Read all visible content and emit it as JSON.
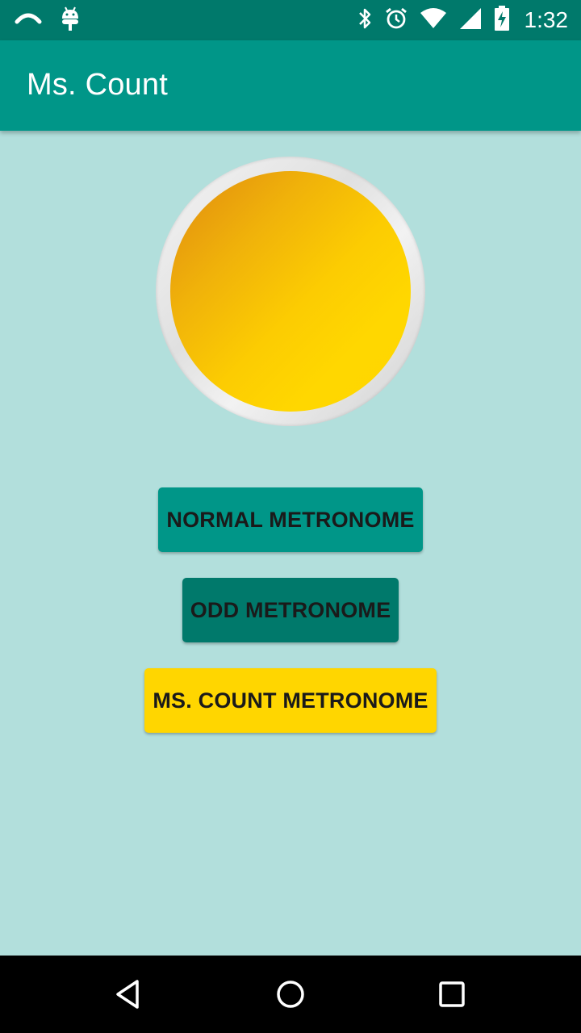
{
  "status_bar": {
    "time": "1:32",
    "left_icons": [
      "notification-icon",
      "android-debug-icon"
    ],
    "right_icons": [
      "bluetooth-icon",
      "alarm-icon",
      "wifi-icon",
      "cellular-signal-icon",
      "battery-charging-icon"
    ]
  },
  "app_bar": {
    "title": "Ms. Count"
  },
  "metronome": {
    "indicator_icon": "beat-light-indicator",
    "color": "#ffd600"
  },
  "buttons": {
    "normal_label": "NORMAL METRONOME",
    "odd_label": "ODD METRONOME",
    "count_label": "MS. COUNT METRONOME"
  },
  "colors": {
    "status_bar": "#00796b",
    "app_bar": "#009688",
    "background": "#b2dfdc",
    "button_normal": "#009688",
    "button_odd": "#00796b",
    "button_count": "#ffd600"
  },
  "nav_bar": {
    "icons": [
      "back-icon",
      "home-icon",
      "recents-icon"
    ]
  }
}
